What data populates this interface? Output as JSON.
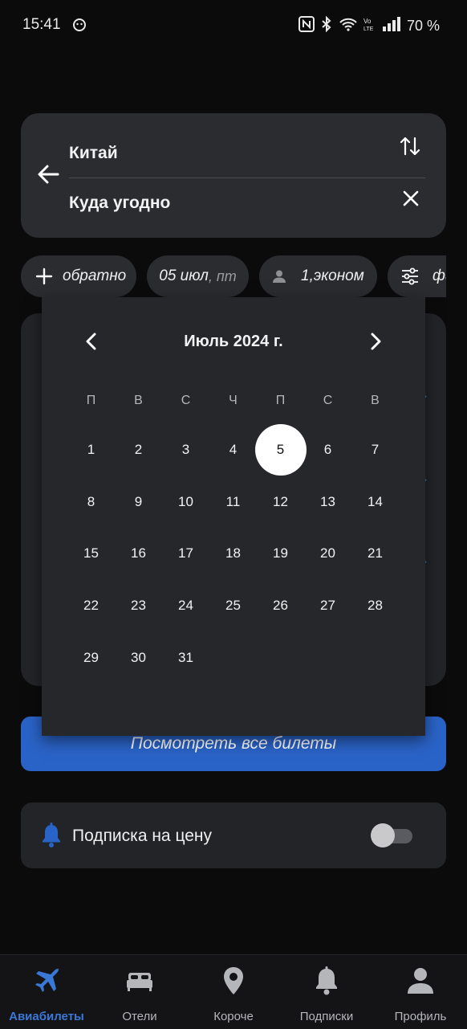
{
  "status_bar": {
    "time": "15:41",
    "battery": "70 %",
    "icons": [
      "smile-face-icon",
      "nfc-icon",
      "bluetooth-icon",
      "wifi-icon",
      "volte-icon",
      "signal-icon"
    ]
  },
  "route": {
    "from": "Китай",
    "to": "Куда угодно",
    "back_icon": "arrow-left-icon",
    "swap_icon": "swap-vertical-icon",
    "clear_icon": "close-icon"
  },
  "chips": {
    "return_label": "обратно",
    "date_main": "05 июл",
    "date_weekday": ", пт",
    "passengers": "1,эконом",
    "filters": "фильтры"
  },
  "calendar": {
    "title": "Июль 2024 г.",
    "weekdays": [
      "П",
      "В",
      "С",
      "Ч",
      "П",
      "С",
      "В"
    ],
    "days": [
      "1",
      "2",
      "3",
      "4",
      "5",
      "6",
      "7",
      "8",
      "9",
      "10",
      "11",
      "12",
      "13",
      "14",
      "15",
      "16",
      "17",
      "18",
      "19",
      "20",
      "21",
      "22",
      "23",
      "24",
      "25",
      "26",
      "27",
      "28",
      "29",
      "30",
      "31"
    ],
    "selected_day": "5"
  },
  "see_all_button": "Посмотреть все билеты",
  "subscription": {
    "label": "Подписка на цену",
    "enabled": false
  },
  "bottom_nav": [
    {
      "label": "Авиабилеты",
      "icon": "airplane-icon",
      "active": true
    },
    {
      "label": "Отели",
      "icon": "bed-icon",
      "active": false
    },
    {
      "label": "Короче",
      "icon": "location-pin-icon",
      "active": false
    },
    {
      "label": "Подписки",
      "icon": "bell-icon",
      "active": false
    },
    {
      "label": "Профиль",
      "icon": "user-icon",
      "active": false
    }
  ],
  "colors": {
    "accent": "#2a63c7",
    "active_nav": "#3a78d6",
    "card": "#2b2c30",
    "background": "#0b0b0c"
  }
}
